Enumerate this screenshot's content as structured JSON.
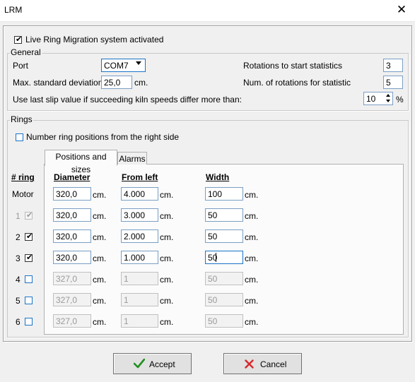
{
  "window": {
    "title": "LRM",
    "close_glyph": "✕"
  },
  "live_ring": {
    "label": "Live Ring Migration system activated",
    "checked": true
  },
  "general": {
    "legend": "General",
    "port": {
      "label": "Port",
      "value": "COM7"
    },
    "max_std_dev": {
      "label": "Max. standard deviation",
      "value": "25,0",
      "unit": "cm."
    },
    "rot_start": {
      "label": "Rotations to start statistics",
      "value": "3"
    },
    "num_rot": {
      "label": "Num. of rotations for statistic",
      "value": "5"
    },
    "slip": {
      "label": "Use last slip value if succeeding kiln speeds differ more than:",
      "value": "10",
      "unit": "%"
    }
  },
  "rings": {
    "legend": "Rings",
    "number_from_right": {
      "label": "Number ring positions from the right side",
      "checked": false
    },
    "tabs": [
      "Positions and sizes",
      "Alarms"
    ],
    "headers": {
      "ring": "# ring",
      "diameter": "Diameter",
      "from_left": "From left",
      "width": "Width"
    },
    "unit": "cm.",
    "rows": [
      {
        "ring": "Motor",
        "diameter": "320,0",
        "from_left": "4.000",
        "width": "100",
        "enabled": true,
        "has_checkbox": false,
        "checked": false
      },
      {
        "ring": "1",
        "diameter": "320,0",
        "from_left": "3.000",
        "width": "50",
        "enabled": true,
        "has_checkbox": true,
        "checked": true,
        "checkbox_disabled": true
      },
      {
        "ring": "2",
        "diameter": "320,0",
        "from_left": "2.000",
        "width": "50",
        "enabled": true,
        "has_checkbox": true,
        "checked": true
      },
      {
        "ring": "3",
        "diameter": "320,0",
        "from_left": "1.000",
        "width": "50",
        "enabled": true,
        "has_checkbox": true,
        "checked": true
      },
      {
        "ring": "4",
        "diameter": "327,0",
        "from_left": "1",
        "width": "50",
        "enabled": false,
        "has_checkbox": true,
        "checked": false
      },
      {
        "ring": "5",
        "diameter": "327,0",
        "from_left": "1",
        "width": "50",
        "enabled": false,
        "has_checkbox": true,
        "checked": false
      },
      {
        "ring": "6",
        "diameter": "327,0",
        "from_left": "1",
        "width": "50",
        "enabled": false,
        "has_checkbox": true,
        "checked": false
      }
    ]
  },
  "buttons": {
    "accept": "Accept",
    "cancel": "Cancel"
  },
  "colors": {
    "accept_check": "#1f8f1f",
    "cancel_x": "#d8282d",
    "focus_border": "#1a73c7"
  }
}
